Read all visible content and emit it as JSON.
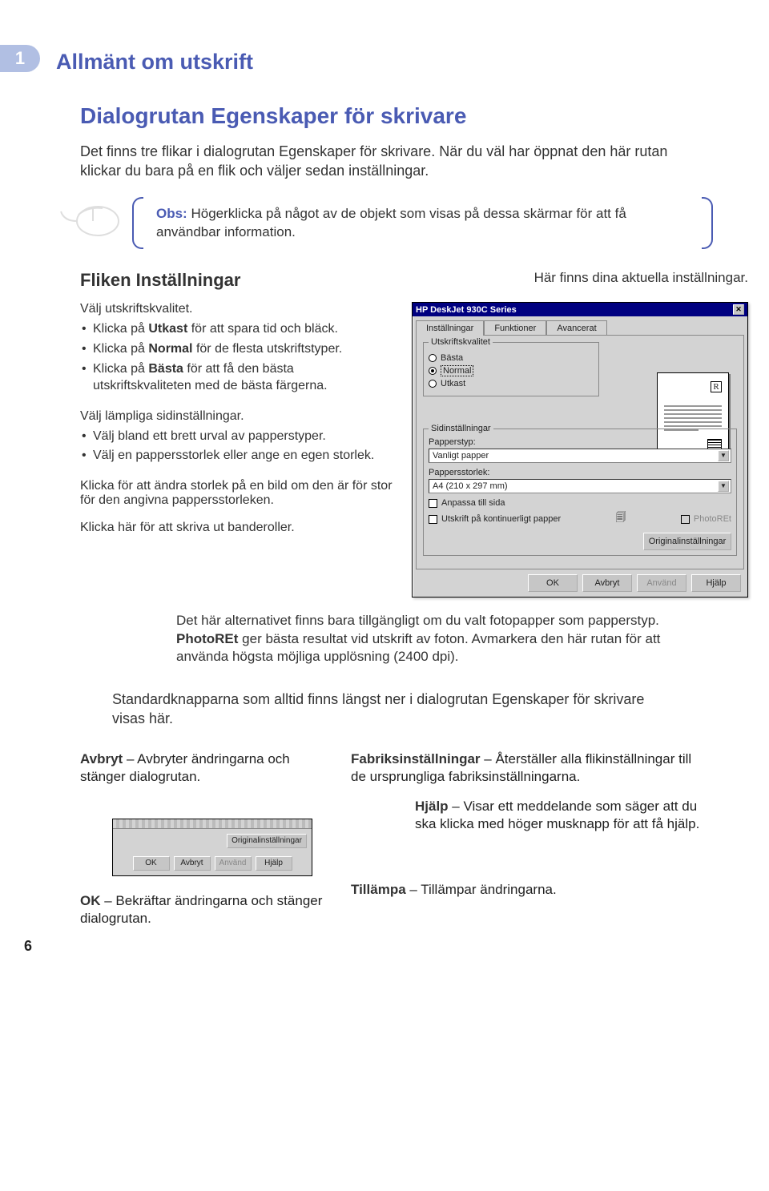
{
  "chapter": {
    "number": "1",
    "title": "Allmänt om utskrift"
  },
  "h2": "Dialogrutan Egenskaper för skrivare",
  "intro": "Det finns tre flikar i dialogrutan Egenskaper för skrivare. När du väl har öppnat den här rutan klickar du bara på en flik och väljer sedan inställningar.",
  "obs": {
    "label": "Obs:",
    "text": "Högerklicka på något av de objekt som visas på dessa skärmar för att få användbar information."
  },
  "h3": "Fliken Inställningar",
  "right_caption": "Här finns dina aktuella inställningar.",
  "quality": {
    "lead": "Välj utskriftskvalitet.",
    "b1a": "Klicka på ",
    "b1b": "Utkast",
    "b1c": " för att spara tid och bläck.",
    "b2a": "Klicka på ",
    "b2b": "Normal",
    "b2c": " för de flesta utskriftstyper.",
    "b3a": "Klicka på ",
    "b3b": "Bästa",
    "b3c": " för att få den bästa utskriftskvaliteten med de bästa färgerna."
  },
  "page_settings": {
    "lead": "Välj lämpliga sidinställningar.",
    "b1": "Välj bland ett brett urval av papperstyper.",
    "b2": "Välj en pappersstorlek eller ange en egen storlek."
  },
  "resize_note": "Klicka för att ändra storlek på en bild om den är för stor för den angivna pappersstorleken.",
  "banner_note": "Klicka här för att skriva ut banderoller.",
  "photo_note_a": "Det här alternativet finns bara tillgängligt om du valt fotopapper som papperstyp. ",
  "photo_note_b": "PhotoREt",
  "photo_note_c": " ger bästa resultat vid utskrift av foton. Avmarkera den här rutan för att använda högsta möjliga upplösning (2400 dpi).",
  "std_note": "Standardknapparna som alltid finns längst ner i dialogrutan Egenskaper för skrivare visas här.",
  "dlg": {
    "title": "HP DeskJet 930C Series",
    "tabs": {
      "t1": "Inställningar",
      "t2": "Funktioner",
      "t3": "Avancerat"
    },
    "group_quality": "Utskriftskvalitet",
    "radio_best": "Bästa",
    "radio_normal": "Normal",
    "radio_draft": "Utkast",
    "group_page": "Sidinställningar",
    "paper_type_label": "Papperstyp:",
    "paper_type_value": "Vanligt papper",
    "paper_size_label": "Pappersstorlek:",
    "paper_size_value": "A4 (210 x 297 mm)",
    "fit": "Anpassa till sida",
    "banner": "Utskrift på kontinuerligt papper",
    "photoret": "PhotoREt",
    "defaults": "Originalinställningar",
    "r": "R",
    "btn_ok": "OK",
    "btn_cancel": "Avbryt",
    "btn_apply": "Använd",
    "btn_help": "Hjälp"
  },
  "bottom": {
    "avbryt_t": "Avbryt",
    "avbryt_d": " – Avbryter ändringarna och stänger dialogrutan.",
    "fabr_t": "Fabriksinställningar",
    "fabr_d": " – Återställer alla flikinställ­ningar till de ursprungliga fabriksinställningarna.",
    "hjalp_t": "Hjälp",
    "hjalp_d": " – Visar ett meddelande som säger att du ska klicka med höger musknapp för att få hjälp.",
    "ok_t": "OK",
    "ok_d": " – Bekräftar ändringarna och stänger dialogrutan.",
    "till_t": "Tillämpa",
    "till_d": " – Tillämpar ändringarna."
  },
  "page_num": "6"
}
